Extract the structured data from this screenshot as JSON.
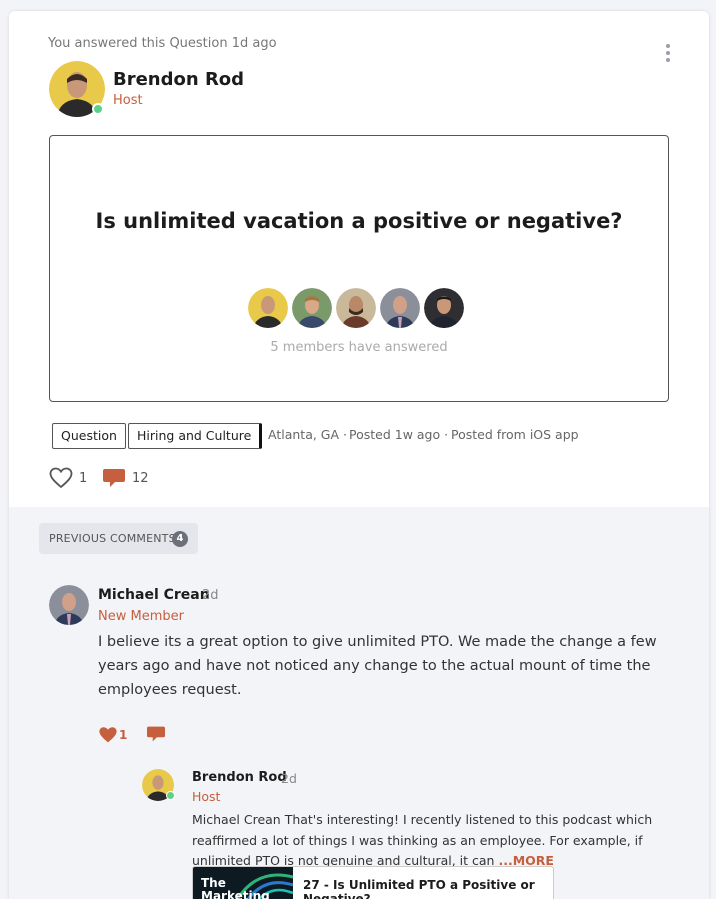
{
  "post": {
    "activity": "You answered this Question 1d ago",
    "author": {
      "name": "Brendon Rod",
      "role": "Host"
    },
    "question": "Is unlimited vacation a positive or negative?",
    "answered_text": "5 members have answered",
    "tags": [
      "Question",
      "Hiring and Culture"
    ],
    "meta": [
      "Atlanta, GA ·",
      "Posted 1w ago ·",
      "Posted from iOS app"
    ],
    "likes": "1",
    "comments": "12"
  },
  "comments_section": {
    "previous_label": "PREVIOUS COMMENTS",
    "previous_count": "4",
    "comment": {
      "name": "Michael Crean",
      "time": "2d",
      "role": "New Member",
      "body": "I believe its a great option to give unlimited PTO.  We made the change a few years ago and have not noticed any change to the actual mount of time the employees request.",
      "likes": "1"
    },
    "reply": {
      "name": "Brendon Rod",
      "time": "2d",
      "role": "Host",
      "body": "Michael Crean That's interesting! I recently listened to this podcast which reaffirmed a lot of things I was thinking as an employee. For example, if unlimited PTO is not genuine and cultural, it can",
      "more": "...MORE",
      "link": {
        "thumb_text": "The Marketing",
        "title": "27 - Is Unlimited PTO a Positive or Negative?"
      }
    }
  },
  "colors": {
    "accent": "#c55f3d",
    "online": "#5dd08b",
    "panel_bg": "#f3f4f7"
  },
  "icons": [
    "more-vertical-icon",
    "heart-outline-icon",
    "comment-bubble-icon",
    "heart-filled-icon"
  ]
}
